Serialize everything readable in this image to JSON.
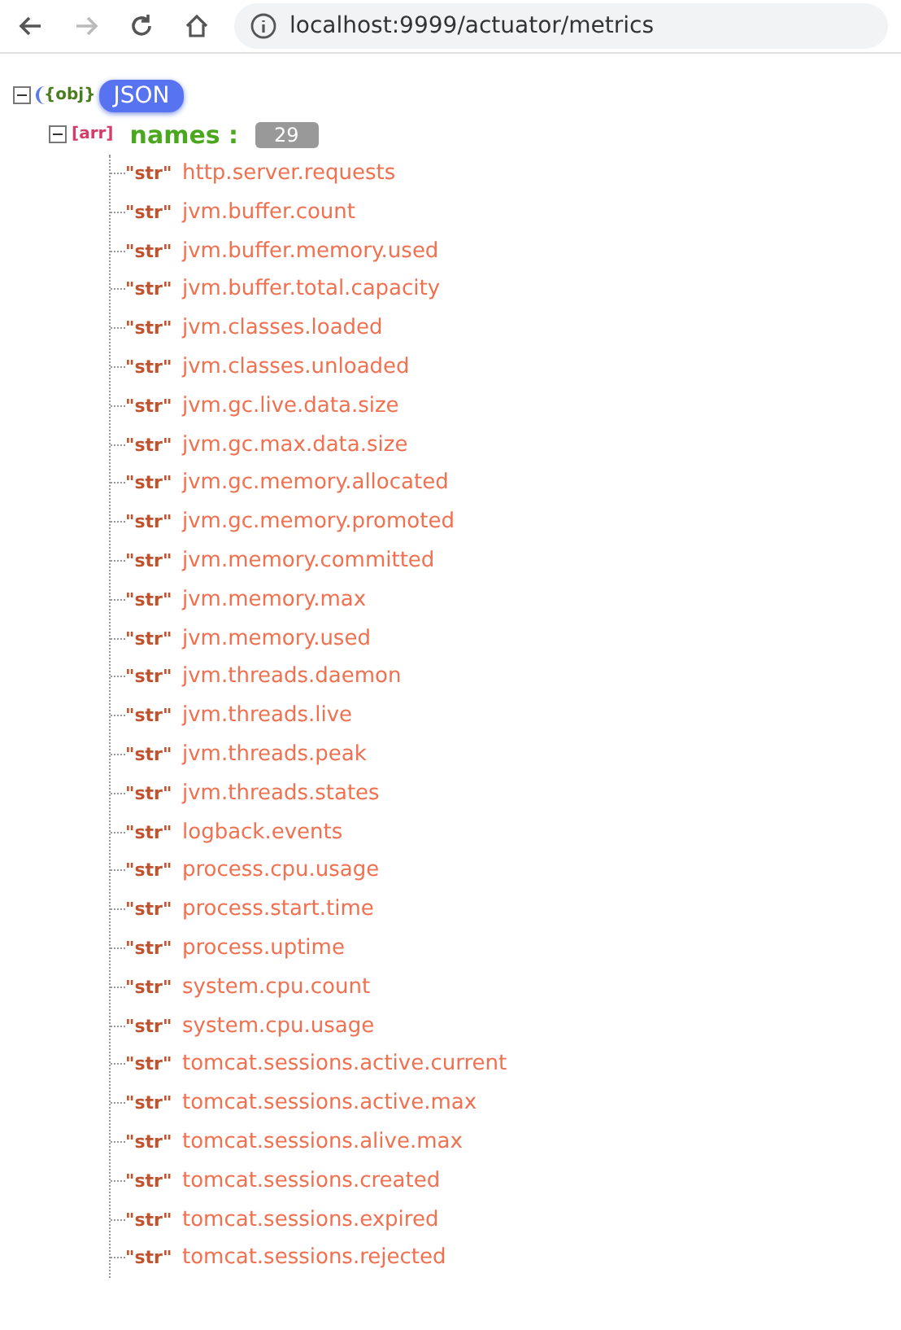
{
  "toolbar": {
    "url": "localhost:9999/actuator/metrics",
    "forward_disabled": true
  },
  "tree": {
    "type_tag": "{obj}",
    "label": "JSON",
    "expanded": true,
    "children": [
      {
        "type_tag": "[arr]",
        "key": "names :",
        "count": "29",
        "expanded": true,
        "children": [
          {
            "type_tag": "\"str\"",
            "value": "http.server.requests"
          },
          {
            "type_tag": "\"str\"",
            "value": "jvm.buffer.count"
          },
          {
            "type_tag": "\"str\"",
            "value": "jvm.buffer.memory.used"
          },
          {
            "type_tag": "\"str\"",
            "value": "jvm.buffer.total.capacity"
          },
          {
            "type_tag": "\"str\"",
            "value": "jvm.classes.loaded"
          },
          {
            "type_tag": "\"str\"",
            "value": "jvm.classes.unloaded"
          },
          {
            "type_tag": "\"str\"",
            "value": "jvm.gc.live.data.size"
          },
          {
            "type_tag": "\"str\"",
            "value": "jvm.gc.max.data.size"
          },
          {
            "type_tag": "\"str\"",
            "value": "jvm.gc.memory.allocated"
          },
          {
            "type_tag": "\"str\"",
            "value": "jvm.gc.memory.promoted"
          },
          {
            "type_tag": "\"str\"",
            "value": "jvm.memory.committed"
          },
          {
            "type_tag": "\"str\"",
            "value": "jvm.memory.max"
          },
          {
            "type_tag": "\"str\"",
            "value": "jvm.memory.used"
          },
          {
            "type_tag": "\"str\"",
            "value": "jvm.threads.daemon"
          },
          {
            "type_tag": "\"str\"",
            "value": "jvm.threads.live"
          },
          {
            "type_tag": "\"str\"",
            "value": "jvm.threads.peak"
          },
          {
            "type_tag": "\"str\"",
            "value": "jvm.threads.states"
          },
          {
            "type_tag": "\"str\"",
            "value": "logback.events"
          },
          {
            "type_tag": "\"str\"",
            "value": "process.cpu.usage"
          },
          {
            "type_tag": "\"str\"",
            "value": "process.start.time"
          },
          {
            "type_tag": "\"str\"",
            "value": "process.uptime"
          },
          {
            "type_tag": "\"str\"",
            "value": "system.cpu.count"
          },
          {
            "type_tag": "\"str\"",
            "value": "system.cpu.usage"
          },
          {
            "type_tag": "\"str\"",
            "value": "tomcat.sessions.active.current"
          },
          {
            "type_tag": "\"str\"",
            "value": "tomcat.sessions.active.max"
          },
          {
            "type_tag": "\"str\"",
            "value": "tomcat.sessions.alive.max"
          },
          {
            "type_tag": "\"str\"",
            "value": "tomcat.sessions.created"
          },
          {
            "type_tag": "\"str\"",
            "value": "tomcat.sessions.expired"
          },
          {
            "type_tag": "\"str\"",
            "value": "tomcat.sessions.rejected"
          }
        ]
      }
    ]
  }
}
